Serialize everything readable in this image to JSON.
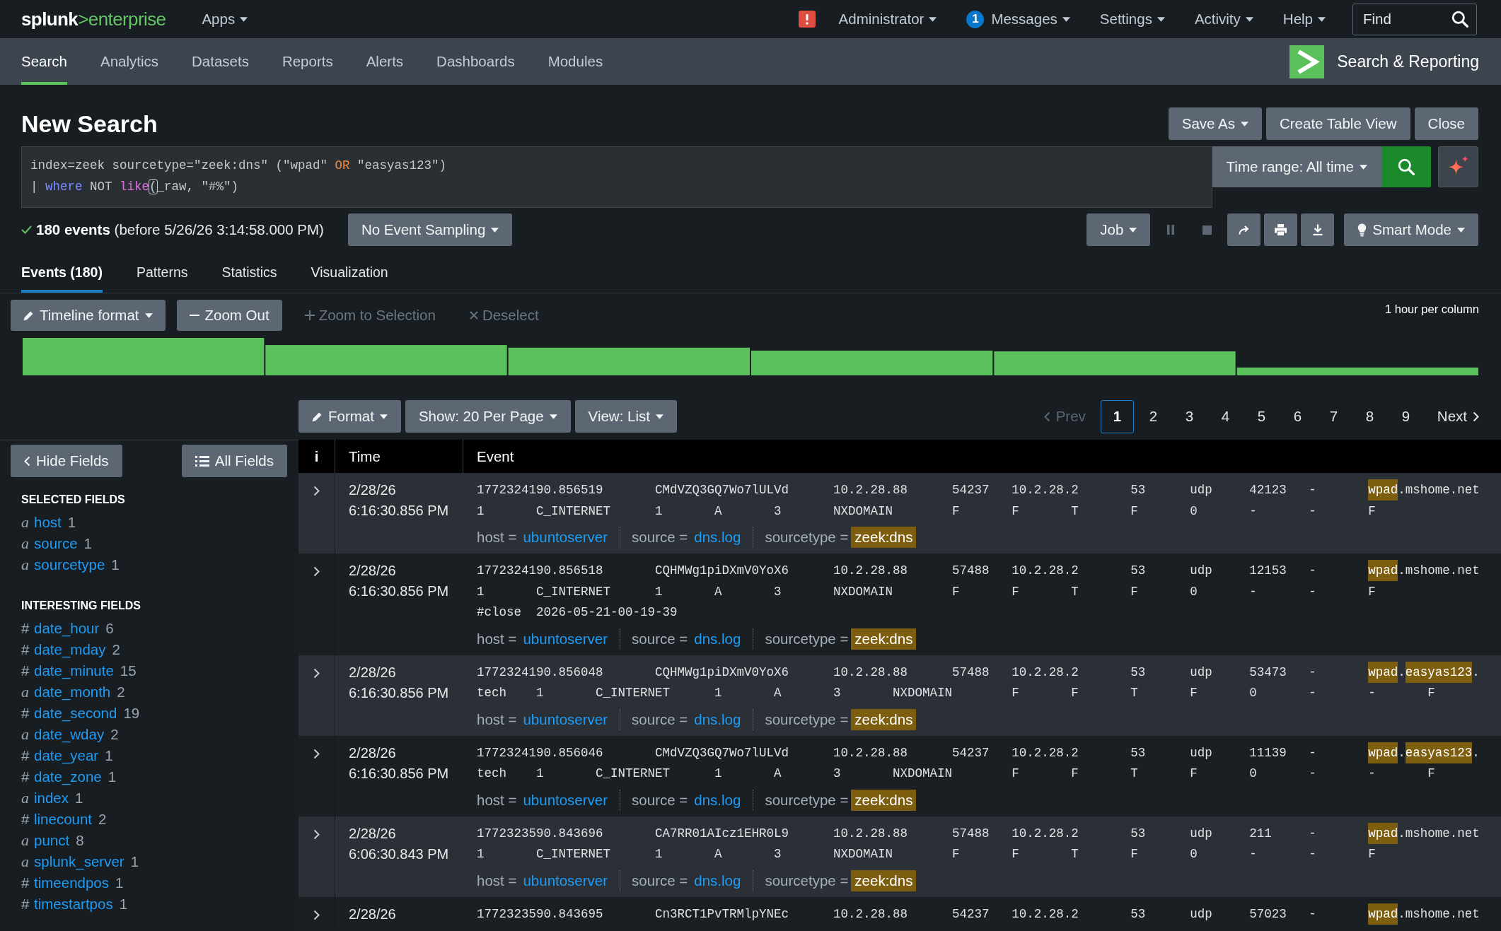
{
  "top_bar": {
    "logo": {
      "primary": "splunk",
      "secondary": ">enterprise"
    },
    "apps_menu": "Apps",
    "user_menu": "Administrator",
    "messages_menu": {
      "label": "Messages",
      "badge": "1"
    },
    "settings_menu": "Settings",
    "activity_menu": "Activity",
    "help_menu": "Help",
    "find_field": {
      "placeholder": "Find"
    }
  },
  "app_bar": {
    "tabs": [
      {
        "label": "Search",
        "selected": true
      },
      {
        "label": "Analytics",
        "selected": false
      },
      {
        "label": "Datasets",
        "selected": false
      },
      {
        "label": "Reports",
        "selected": false
      },
      {
        "label": "Alerts",
        "selected": false
      },
      {
        "label": "Dashboards",
        "selected": false
      },
      {
        "label": "Modules",
        "selected": false
      }
    ],
    "app_title": "Search & Reporting"
  },
  "search_page": {
    "title": "New Search",
    "save_as": "Save As",
    "create_table_view": "Create Table View",
    "close": "Close",
    "query_lines": [
      [
        {
          "text": "index=zeek sourcetype=\"zeek:dns\" (\"wpad\" ",
          "kind": "plain"
        },
        {
          "text": "OR",
          "kind": "operator"
        },
        {
          "text": " \"easyas123\")",
          "kind": "plain"
        }
      ],
      [
        {
          "text": "| ",
          "kind": "plain"
        },
        {
          "text": "where",
          "kind": "command"
        },
        {
          "text": " NOT ",
          "kind": "plain"
        },
        {
          "text": "like",
          "kind": "function"
        },
        {
          "text": "(",
          "kind": "matched_bracket"
        },
        {
          "text": "_raw, \"#%\")",
          "kind": "plain"
        }
      ]
    ],
    "time_range": "Time range: All time"
  },
  "job_bar": {
    "summary": "**180 events** (before 5/26/26 3:14:58.000 PM)",
    "sampling": "No Event Sampling",
    "job_menu": "Job",
    "controls": [
      {
        "kind": "pause",
        "disabled": true
      },
      {
        "kind": "stop",
        "disabled": true
      },
      {
        "kind": "share",
        "disabled": false
      },
      {
        "kind": "print",
        "disabled": false
      },
      {
        "kind": "export",
        "disabled": false
      }
    ],
    "search_mode": "Smart Mode"
  },
  "result_tabs": [
    {
      "label": "Events (180)",
      "selected": true
    },
    {
      "label": "Patterns",
      "selected": false
    },
    {
      "label": "Statistics",
      "selected": false
    },
    {
      "label": "Visualization",
      "selected": false
    }
  ],
  "timeline": {
    "buttons": [
      {
        "kind": "format",
        "label": "Timeline format",
        "disabled": false
      },
      {
        "kind": "zoom_out",
        "label": "Zoom Out",
        "disabled": false
      },
      {
        "kind": "zoom_to_selection",
        "label": "Zoom to Selection",
        "disabled": true
      },
      {
        "kind": "deselect",
        "label": "Deselect",
        "disabled": true
      }
    ],
    "scale_note": "1 hour per column"
  },
  "results_toolbar": {
    "format_menu": "Format",
    "page_size_menu": "Show: 20 Per Page",
    "view_menu": "View: List",
    "pagination": {
      "prev": {
        "label": "Prev",
        "disabled": true
      },
      "pages": [
        {
          "label": "1",
          "selected": true
        },
        {
          "label": "2",
          "selected": false
        },
        {
          "label": "3",
          "selected": false
        },
        {
          "label": "4",
          "selected": false
        },
        {
          "label": "5",
          "selected": false
        },
        {
          "label": "6",
          "selected": false
        },
        {
          "label": "7",
          "selected": false
        },
        {
          "label": "8",
          "selected": false
        },
        {
          "label": "9",
          "selected": false
        }
      ],
      "next": {
        "label": "Next",
        "disabled": false
      }
    }
  },
  "fields_sidebar": {
    "hide_button": "Hide Fields",
    "all_button": "All Fields",
    "groups": [
      {
        "heading": "SELECTED FIELDS",
        "fields": [
          {
            "kind": "string",
            "symbol": "a",
            "name": "host",
            "count": "1"
          },
          {
            "kind": "string",
            "symbol": "a",
            "name": "source",
            "count": "1"
          },
          {
            "kind": "string",
            "symbol": "a",
            "name": "sourcetype",
            "count": "1"
          }
        ]
      },
      {
        "heading": "INTERESTING FIELDS",
        "fields": [
          {
            "kind": "number",
            "symbol": "#",
            "name": "date_hour",
            "count": "6"
          },
          {
            "kind": "number",
            "symbol": "#",
            "name": "date_mday",
            "count": "2"
          },
          {
            "kind": "number",
            "symbol": "#",
            "name": "date_minute",
            "count": "15"
          },
          {
            "kind": "string",
            "symbol": "a",
            "name": "date_month",
            "count": "2"
          },
          {
            "kind": "number",
            "symbol": "#",
            "name": "date_second",
            "count": "19"
          },
          {
            "kind": "string",
            "symbol": "a",
            "name": "date_wday",
            "count": "2"
          },
          {
            "kind": "number",
            "symbol": "#",
            "name": "date_year",
            "count": "1"
          },
          {
            "kind": "number",
            "symbol": "#",
            "name": "date_zone",
            "count": "1"
          },
          {
            "kind": "string",
            "symbol": "a",
            "name": "index",
            "count": "1"
          },
          {
            "kind": "number",
            "symbol": "#",
            "name": "linecount",
            "count": "2"
          },
          {
            "kind": "string",
            "symbol": "a",
            "name": "punct",
            "count": "8"
          },
          {
            "kind": "string",
            "symbol": "a",
            "name": "splunk_server",
            "count": "1"
          },
          {
            "kind": "number",
            "symbol": "#",
            "name": "timeendpos",
            "count": "1"
          },
          {
            "kind": "number",
            "symbol": "#",
            "name": "timestartpos",
            "count": "1"
          }
        ]
      }
    ]
  },
  "events_table": {
    "columns": [
      {
        "label": "i"
      },
      {
        "label": "Time"
      },
      {
        "label": "Event"
      }
    ],
    "rows": [
      {
        "expanded": false,
        "date": "2/28/26",
        "time": "6:16:30.856 PM",
        "lines": [
          [
            {
              "text": "1772324190.856519\tCMdVZQ3GQ7Wo7lULVd\t10.2.28.88\t54237\t10.2.28.2\t53\tudp\t42123\t-\t",
              "highlighted": false
            },
            {
              "text": "wpad",
              "highlighted": true
            },
            {
              "text": ".mshome.net",
              "highlighted": false
            }
          ],
          [
            {
              "text": "1\tC_INTERNET\t1\tA\t3\tNXDOMAIN\tF\tF\tT\tF\t0\t-\t-\tF",
              "highlighted": false
            }
          ]
        ],
        "fields": [
          {
            "label": "host =",
            "value": "ubuntoserver",
            "highlighted": false
          },
          {
            "label": "source =",
            "value": "dns.log",
            "highlighted": false
          },
          {
            "label": "sourcetype =",
            "value": "zeek:dns",
            "highlighted": true
          }
        ]
      },
      {
        "expanded": false,
        "date": "2/28/26",
        "time": "6:16:30.856 PM",
        "lines": [
          [
            {
              "text": "1772324190.856518\tCQHMWg1piDXmV0YoX6\t10.2.28.88\t57488\t10.2.28.2\t53\tudp\t12153\t-\t",
              "highlighted": false
            },
            {
              "text": "wpad",
              "highlighted": true
            },
            {
              "text": ".mshome.net",
              "highlighted": false
            }
          ],
          [
            {
              "text": "1\tC_INTERNET\t1\tA\t3\tNXDOMAIN\tF\tF\tT\tF\t0\t-\t-\tF",
              "highlighted": false
            }
          ],
          [
            {
              "text": "#close\t2026-05-21-00-19-39",
              "highlighted": false
            }
          ]
        ],
        "fields": [
          {
            "label": "host =",
            "value": "ubuntoserver",
            "highlighted": false
          },
          {
            "label": "source =",
            "value": "dns.log",
            "highlighted": false
          },
          {
            "label": "sourcetype =",
            "value": "zeek:dns",
            "highlighted": true
          }
        ]
      },
      {
        "expanded": false,
        "date": "2/28/26",
        "time": "6:16:30.856 PM",
        "lines": [
          [
            {
              "text": "1772324190.856048\tCQHMWg1piDXmV0YoX6\t10.2.28.88\t57488\t10.2.28.2\t53\tudp\t53473\t-\t",
              "highlighted": false
            },
            {
              "text": "wpad",
              "highlighted": true
            },
            {
              "text": ".",
              "highlighted": false
            },
            {
              "text": "easyas123",
              "highlighted": true
            },
            {
              "text": ".",
              "highlighted": false
            }
          ],
          [
            {
              "text": "tech\t1\tC_INTERNET\t1\tA\t3\tNXDOMAIN\tF\tF\tT\tF\t0\t-\t-\tF",
              "highlighted": false
            }
          ]
        ],
        "fields": [
          {
            "label": "host =",
            "value": "ubuntoserver",
            "highlighted": false
          },
          {
            "label": "source =",
            "value": "dns.log",
            "highlighted": false
          },
          {
            "label": "sourcetype =",
            "value": "zeek:dns",
            "highlighted": true
          }
        ]
      },
      {
        "expanded": false,
        "date": "2/28/26",
        "time": "6:16:30.856 PM",
        "lines": [
          [
            {
              "text": "1772324190.856046\tCMdVZQ3GQ7Wo7lULVd\t10.2.28.88\t54237\t10.2.28.2\t53\tudp\t11139\t-\t",
              "highlighted": false
            },
            {
              "text": "wpad",
              "highlighted": true
            },
            {
              "text": ".",
              "highlighted": false
            },
            {
              "text": "easyas123",
              "highlighted": true
            },
            {
              "text": ".",
              "highlighted": false
            }
          ],
          [
            {
              "text": "tech\t1\tC_INTERNET\t1\tA\t3\tNXDOMAIN\tF\tF\tT\tF\t0\t-\t-\tF",
              "highlighted": false
            }
          ]
        ],
        "fields": [
          {
            "label": "host =",
            "value": "ubuntoserver",
            "highlighted": false
          },
          {
            "label": "source =",
            "value": "dns.log",
            "highlighted": false
          },
          {
            "label": "sourcetype =",
            "value": "zeek:dns",
            "highlighted": true
          }
        ]
      },
      {
        "expanded": false,
        "date": "2/28/26",
        "time": "6:06:30.843 PM",
        "lines": [
          [
            {
              "text": "1772323590.843696\tCA7RR01AIcz1EHR0L9\t10.2.28.88\t57488\t10.2.28.2\t53\tudp\t211\t-\t",
              "highlighted": false
            },
            {
              "text": "wpad",
              "highlighted": true
            },
            {
              "text": ".mshome.net",
              "highlighted": false
            }
          ],
          [
            {
              "text": "1\tC_INTERNET\t1\tA\t3\tNXDOMAIN\tF\tF\tT\tF\t0\t-\t-\tF",
              "highlighted": false
            }
          ]
        ],
        "fields": [
          {
            "label": "host =",
            "value": "ubuntoserver",
            "highlighted": false
          },
          {
            "label": "source =",
            "value": "dns.log",
            "highlighted": false
          },
          {
            "label": "sourcetype =",
            "value": "zeek:dns",
            "highlighted": true
          }
        ]
      },
      {
        "expanded": false,
        "date": "2/28/26",
        "lines": [
          [
            {
              "text": "1772323590.843695\tCn3RCT1PvTRMlpYNEc\t10.2.28.88\t54237\t10.2.28.2\t53\tudp\t57023\t-\t",
              "highlighted": false
            },
            {
              "text": "wpad",
              "highlighted": true
            },
            {
              "text": ".mshome.net",
              "highlighted": false
            }
          ]
        ]
      }
    ]
  }
}
